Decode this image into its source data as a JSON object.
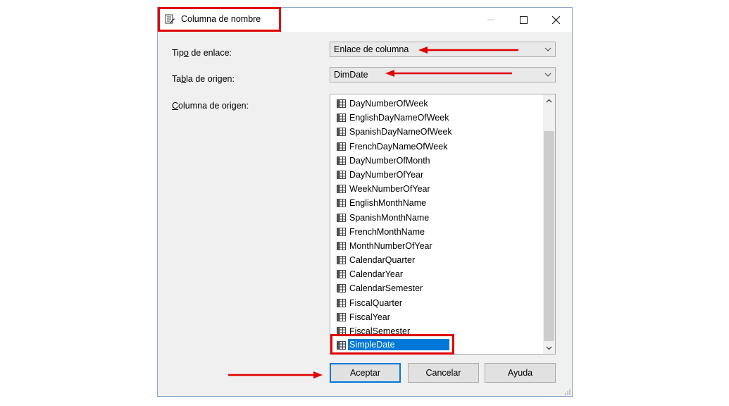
{
  "window": {
    "title": "Columna de nombre",
    "title_icon": "dialog-edit-icon",
    "controls": {
      "minimize": "minimize-icon",
      "maximize": "maximize-icon",
      "close": "close-icon"
    }
  },
  "form": {
    "binding_type_label_pre": "Tip",
    "binding_type_label_key": "o",
    "binding_type_label_post": " de enlace:",
    "binding_type_value": "Enlace de columna",
    "source_table_label_pre": "Ta",
    "source_table_label_key": "b",
    "source_table_label_post": "la de origen:",
    "source_table_value": "DimDate",
    "source_column_label_pre": "",
    "source_column_label_key": "C",
    "source_column_label_post": "olumna de origen:"
  },
  "columns": [
    "DayNumberOfWeek",
    "EnglishDayNameOfWeek",
    "SpanishDayNameOfWeek",
    "FrenchDayNameOfWeek",
    "DayNumberOfMonth",
    "DayNumberOfYear",
    "WeekNumberOfYear",
    "EnglishMonthName",
    "SpanishMonthName",
    "FrenchMonthName",
    "MonthNumberOfYear",
    "CalendarQuarter",
    "CalendarYear",
    "CalendarSemester",
    "FiscalQuarter",
    "FiscalYear",
    "FiscalSemester",
    "SimpleDate"
  ],
  "selected_column": "SimpleDate",
  "buttons": {
    "ok": "Aceptar",
    "cancel": "Cancelar",
    "help": "Ayuda"
  },
  "colors": {
    "annotation": "#e00000",
    "selection": "#0078d7"
  }
}
